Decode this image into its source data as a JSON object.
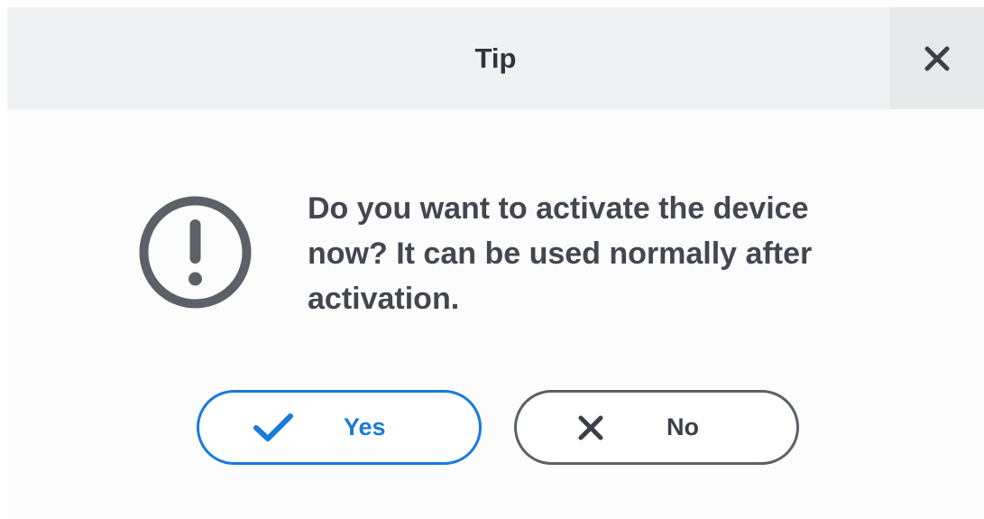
{
  "dialog": {
    "title": "Tip",
    "close_icon": "close-icon",
    "alert_icon": "exclamation-circle-icon",
    "message": "Do you want to activate the device now? It can be used normally after activation.",
    "buttons": {
      "yes": {
        "label": "Yes",
        "icon": "checkmark-icon"
      },
      "no": {
        "label": "No",
        "icon": "close-icon"
      }
    }
  },
  "colors": {
    "accent": "#1a7ad9",
    "text": "#424750",
    "title_bar": "#f0f1f2",
    "icon_gray": "#5c6168"
  }
}
